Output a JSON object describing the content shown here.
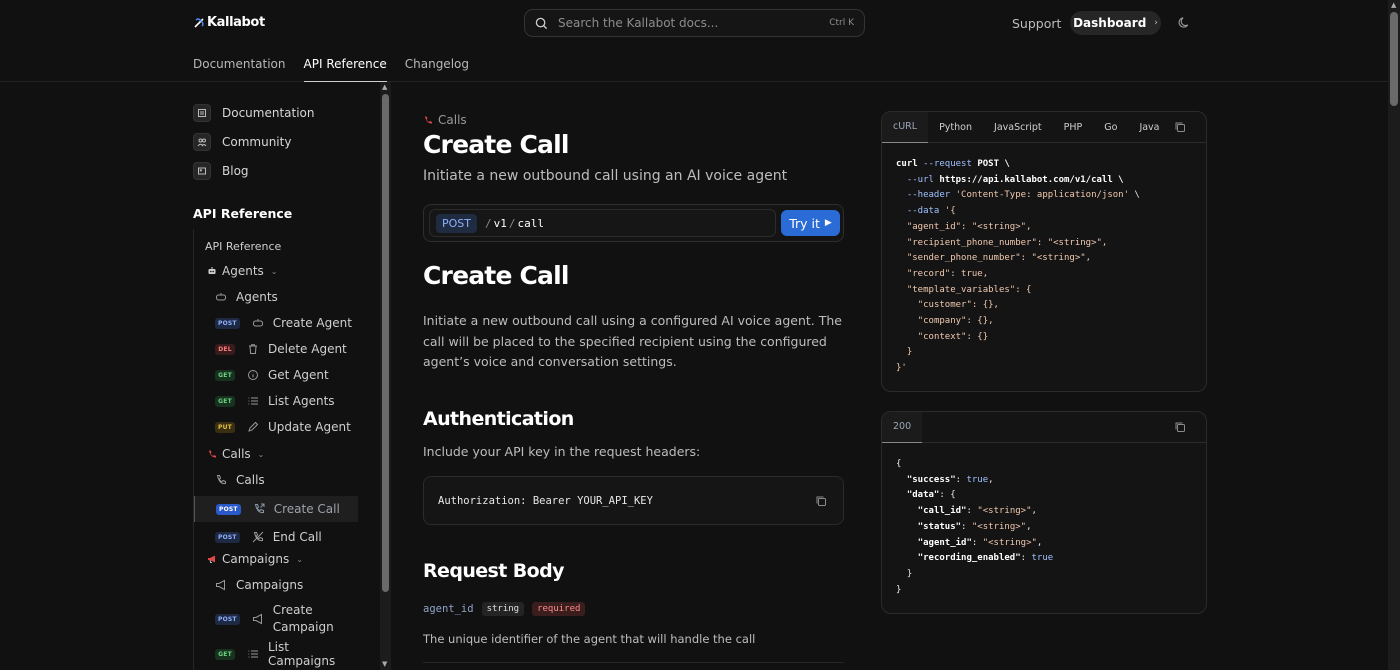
{
  "header": {
    "logo_text": "Kallabot",
    "search_placeholder": "Search the Kallabot docs...",
    "search_shortcut": "Ctrl K",
    "support_label": "Support",
    "dashboard_label": "Dashboard",
    "nav_tabs": [
      {
        "label": "Documentation"
      },
      {
        "label": "API Reference"
      },
      {
        "label": "Changelog"
      }
    ]
  },
  "sidebar": {
    "top_links": [
      {
        "label": "Documentation"
      },
      {
        "label": "Community"
      },
      {
        "label": "Blog"
      }
    ],
    "section_title": "API Reference",
    "overview": "API Reference",
    "groups": {
      "agents": {
        "label": "Agents",
        "items": [
          {
            "label": "Agents"
          },
          {
            "method": "POST",
            "label": "Create Agent"
          },
          {
            "method": "DEL",
            "label": "Delete Agent"
          },
          {
            "method": "GET",
            "label": "Get Agent"
          },
          {
            "method": "GET",
            "label": "List Agents"
          },
          {
            "method": "PUT",
            "label": "Update Agent"
          }
        ]
      },
      "calls": {
        "label": "Calls",
        "items": [
          {
            "label": "Calls"
          },
          {
            "method": "POST",
            "label": "Create Call"
          },
          {
            "method": "POST",
            "label": "End Call"
          }
        ]
      },
      "campaigns": {
        "label": "Campaigns",
        "items": [
          {
            "label": "Campaigns"
          },
          {
            "method": "POST",
            "label_line1": "Create",
            "label_line2": "Campaign"
          },
          {
            "method": "GET",
            "label": "List Campaigns"
          }
        ]
      }
    }
  },
  "main": {
    "breadcrumb": "Calls",
    "title": "Create Call",
    "subtitle": "Initiate a new outbound call using an AI voice agent",
    "endpoint": {
      "method": "POST",
      "seg1": "v1",
      "seg2": "call",
      "try_label": "Try it"
    },
    "section_title": "Create Call",
    "description": "Initiate a new outbound call using a configured AI voice agent. The call will be placed to the specified recipient using the configured agent’s voice and conversation settings.",
    "auth_title": "Authentication",
    "auth_text": "Include your API key in the request headers:",
    "auth_code": "Authorization: Bearer YOUR_API_KEY",
    "body_title": "Request Body",
    "param": {
      "name": "agent_id",
      "type": "string",
      "required": "required",
      "description": "The unique identifier of the agent that will handle the call"
    }
  },
  "request_panel": {
    "tabs": [
      {
        "label": "cURL"
      },
      {
        "label": "Python"
      },
      {
        "label": "JavaScript"
      },
      {
        "label": "PHP"
      },
      {
        "label": "Go"
      },
      {
        "label": "Java"
      }
    ],
    "code_lines": {
      "l1_cmd": "curl",
      "l1_flag": "--request",
      "l1_val": "POST \\",
      "l2_flag": "--url",
      "l2_val": "https://api.kallabot.com/v1/call \\",
      "l3_flag": "--header",
      "l3_val": "'Content-Type: application/json'",
      "l3_tail": " \\",
      "l4_flag": "--data",
      "l4_val": "'{",
      "l5": "\"agent_id\": \"<string>\",",
      "l6": "\"recipient_phone_number\": \"<string>\",",
      "l7": "\"sender_phone_number\": \"<string>\",",
      "l8": "\"record\": true,",
      "l9": "\"template_variables\": {",
      "l10": "\"customer\": {},",
      "l11": "\"company\": {},",
      "l12": "\"context\": {}",
      "l13": "}",
      "l14": "}'"
    }
  },
  "response_panel": {
    "status": "200",
    "lines": {
      "l1": "{",
      "l2_key": "\"success\"",
      "l2_val": "true",
      "l3_key": "\"data\"",
      "l3_tail": ": {",
      "l4_key": "\"call_id\"",
      "l4_val": "\"<string>\"",
      "l5_key": "\"status\"",
      "l5_val": "\"<string>\"",
      "l6_key": "\"agent_id\"",
      "l6_val": "\"<string>\"",
      "l7_key": "\"recording_enabled\"",
      "l7_val": "true",
      "l8": "}",
      "l9": "}"
    }
  },
  "colors": {
    "background": "#111111",
    "accent_blue": "#2a6bd6",
    "post_badge": "#8fb0ff",
    "get_badge": "#6bd483",
    "del_badge": "#ff7b7b",
    "put_badge": "#e5c14a"
  },
  "icons": {
    "logo": "phone-slash-logo-icon",
    "search": "search-icon",
    "theme": "moon-icon",
    "copy": "copy-icon",
    "calls": "phone-icon",
    "agents": "robot-icon",
    "campaigns": "megaphone-icon"
  }
}
